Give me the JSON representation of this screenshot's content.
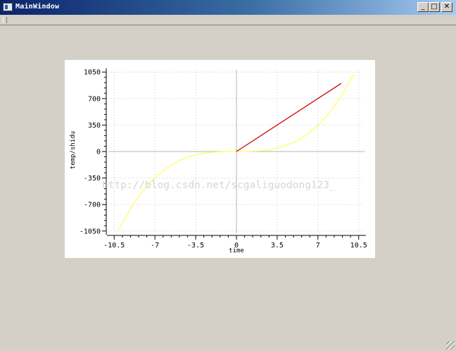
{
  "window": {
    "title": "MainWindow",
    "minimize_glyph": "_",
    "maximize_glyph": "□",
    "close_glyph": "✕"
  },
  "watermark": "http://blog.csdn.net/scgaliguodong123_",
  "chart_data": {
    "type": "line",
    "title": "",
    "xlabel": "time",
    "ylabel": "temp/shidu",
    "xlim": [
      -11,
      11
    ],
    "ylim": [
      -1080,
      1080
    ],
    "xticks": [
      "-10.5",
      "-7",
      "-3.5",
      "0",
      "3.5",
      "7",
      "10.5"
    ],
    "yticks": [
      "1050",
      "700",
      "350",
      "0",
      "-350",
      "-700",
      "-1050"
    ],
    "grid": true,
    "series": [
      {
        "color": "#ffff66",
        "x": [
          -10.1,
          -9,
          -8,
          -7,
          -6,
          -5,
          -4,
          -3,
          -2,
          -1,
          0,
          1,
          2,
          3,
          4,
          5,
          6,
          7,
          8,
          9,
          10.1
        ],
        "y": [
          -1030,
          -730,
          -512,
          -343,
          -216,
          -125,
          -64,
          -27,
          -8,
          -1,
          0,
          1,
          8,
          27,
          64,
          125,
          216,
          343,
          512,
          729,
          1030
        ]
      },
      {
        "color": "#cc0000",
        "x": [
          0,
          9
        ],
        "y": [
          0,
          900
        ]
      }
    ]
  }
}
